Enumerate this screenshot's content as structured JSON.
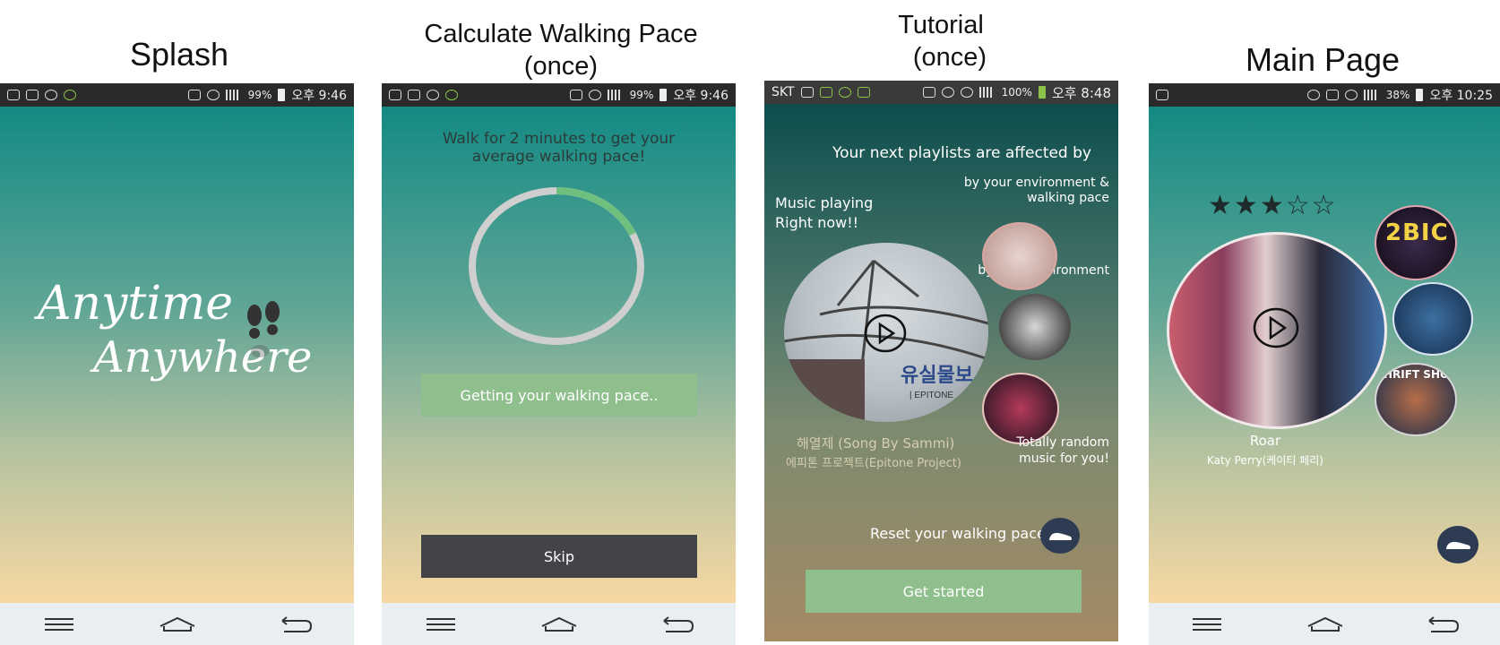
{
  "captions": {
    "splash": "Splash",
    "calc": "Calculate Walking Pace",
    "calc_sub": "(once)",
    "tutorial": "Tutorial",
    "tutorial_sub": "(once)",
    "main": "Main Page"
  },
  "colors": {
    "teal_top": "#138a83",
    "peach_bottom": "#f7d8a3",
    "green_button": "#8fbf8c",
    "dark_button": "#434447",
    "navbar": "#e9eef1"
  },
  "splash": {
    "status": {
      "battery": "99%",
      "time": "오후 9:46"
    },
    "title_line1": "Anytime",
    "title_line2": "Anywhere",
    "logo_icon": "footprints-icon"
  },
  "calc": {
    "status": {
      "battery": "99%",
      "time": "오후 9:46"
    },
    "instruction": "Walk for 2 minutes to get your average walking pace!",
    "progress_fraction": 0.18,
    "status_button": "Getting your walking pace..",
    "skip_button": "Skip"
  },
  "tutorial": {
    "status": {
      "carrier": "SKT",
      "battery": "100%",
      "time": "오후 8:48"
    },
    "heading": "Your next playlists are affected by",
    "now_playing_label": "Music playing Right now!!",
    "env_pace_label": "by your environment & walking pace",
    "env_label": "by your environment",
    "random_label": "Totally random music for you!",
    "album_text": "유실물보",
    "album_sub": "| EPITONE",
    "song_title": "해열제 (Song By Sammi)",
    "song_artist": "에피톤 프로젝트(Epitone Project)",
    "reset_label": "Reset your walking pace",
    "get_started_button": "Get started"
  },
  "main": {
    "status": {
      "battery": "38%",
      "time": "오후 10:25"
    },
    "rating": 3,
    "rating_max": 5,
    "song_title": "Roar",
    "song_artist": "Katy Perry(케이티 페리)",
    "album_top": "2BIC",
    "album_bottom": "HRIFT SHO"
  }
}
